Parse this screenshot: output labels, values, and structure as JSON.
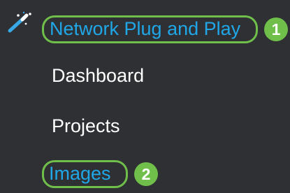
{
  "icons": {
    "wand": "magic-wand-icon"
  },
  "nav": {
    "items": [
      {
        "label": "Network Plug and Play",
        "state": "active"
      },
      {
        "label": "Dashboard",
        "state": "default"
      },
      {
        "label": "Projects",
        "state": "default"
      },
      {
        "label": "Images",
        "state": "active"
      }
    ]
  },
  "callouts": [
    {
      "number": "1"
    },
    {
      "number": "2"
    }
  ],
  "colors": {
    "background": "#2f3033",
    "active_text": "#1fa7e8",
    "default_text": "#ffffff",
    "highlight": "#6fbf4a",
    "wand_icon": "#39a8e6"
  }
}
